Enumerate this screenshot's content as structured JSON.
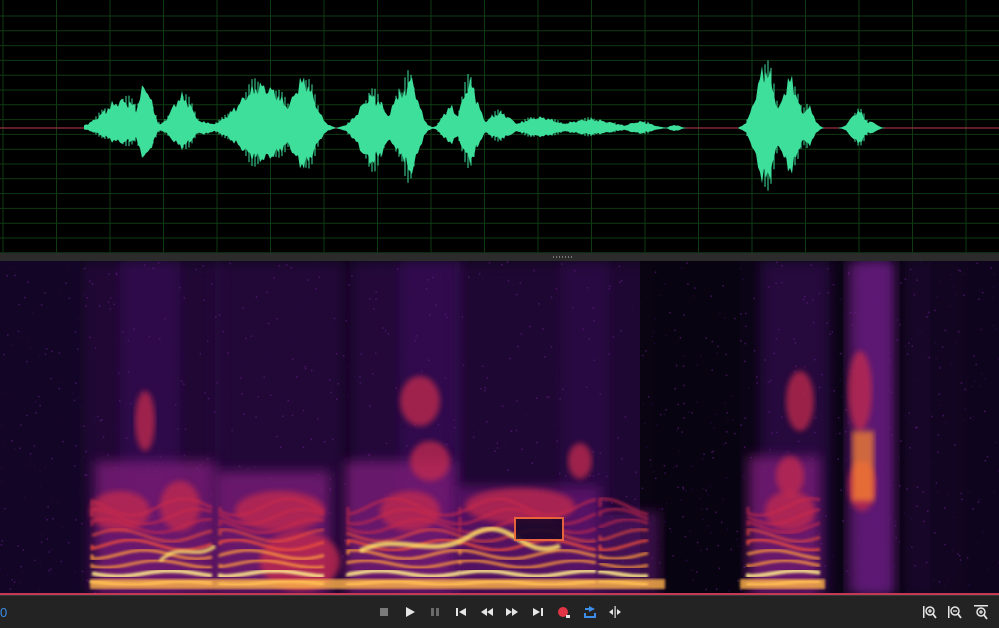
{
  "waveform": {
    "background": "#000000",
    "wave_color": "#3ddf9b",
    "grid_color": "#0f3a12",
    "center_line_color": "#c0384f"
  },
  "spectrogram": {
    "colormap": "inferno"
  },
  "transport": {
    "time_readout": "0",
    "icons": {
      "stop": "stop-icon",
      "play": "play-icon",
      "pause": "pause-icon",
      "skip_start": "skip-to-start-icon",
      "rewind": "rewind-icon",
      "fast_forward": "fast-forward-icon",
      "skip_end": "skip-to-end-icon",
      "record": "record-icon",
      "loop": "loop-icon",
      "skip_selection": "skip-selection-icon",
      "zoom_in": "zoom-in-icon",
      "zoom_out": "zoom-out-icon",
      "zoom_selection": "zoom-selection-icon"
    },
    "accent": "#3d8ee8",
    "record_color": "#e03545"
  }
}
